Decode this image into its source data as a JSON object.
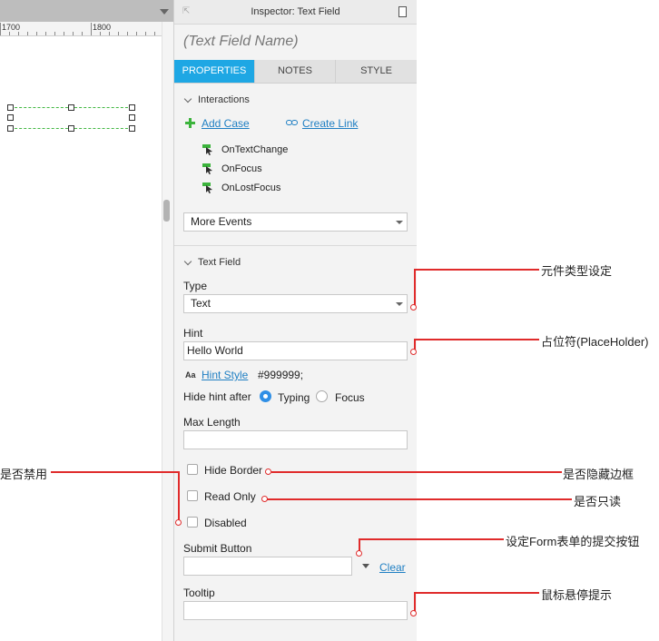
{
  "canvas": {
    "ruler_labels": [
      "1700",
      "1800"
    ]
  },
  "inspector": {
    "title": "Inspector: Text Field",
    "widget_name": "(Text Field Name)",
    "tabs": [
      {
        "label": "PROPERTIES",
        "active": true
      },
      {
        "label": "NOTES",
        "active": false
      },
      {
        "label": "STYLE",
        "active": false
      }
    ],
    "interactions": {
      "title": "Interactions",
      "add_case": "Add Case",
      "create_link": "Create Link",
      "events": [
        "OnTextChange",
        "OnFocus",
        "OnLostFocus"
      ],
      "more_events": "More Events"
    },
    "text_field": {
      "title": "Text Field",
      "type_label": "Type",
      "type_value": "Text",
      "hint_label": "Hint",
      "hint_value": "Hello World",
      "hint_style_label": "Hint Style",
      "hint_style_value": "#999999;",
      "hide_hint_label": "Hide hint after",
      "radio_typing": "Typing",
      "radio_focus": "Focus",
      "radio_selected": "Typing",
      "max_length_label": "Max Length",
      "max_length_value": "",
      "hide_border": "Hide Border",
      "read_only": "Read Only",
      "disabled": "Disabled",
      "submit_button_label": "Submit Button",
      "submit_button_value": "",
      "clear": "Clear",
      "tooltip_label": "Tooltip",
      "tooltip_value": ""
    }
  },
  "annotations": {
    "type": "元件类型设定",
    "placeholder": "占位符(PlaceHolder)",
    "disabled": "是否禁用",
    "hide_border": "是否隐藏边框",
    "read_only": "是否只读",
    "submit": "设定Form表单的提交按钮",
    "tooltip": "鼠标悬停提示"
  },
  "colors": {
    "accent": "#1ea7e4",
    "link": "#1f7fc3",
    "annotation": "#e02b2b",
    "add_icon": "#3bb33b"
  }
}
